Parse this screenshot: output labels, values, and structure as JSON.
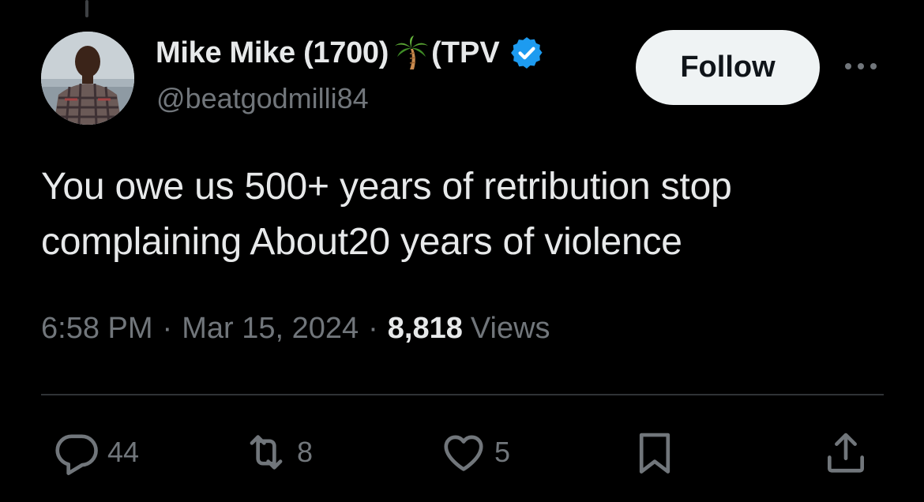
{
  "tweet": {
    "display_name": "Mike Mike (1700)",
    "name_emoji": "palm-tree",
    "name_suffix": "(TPV",
    "verified": true,
    "handle": "@beatgodmilli84",
    "text": "You owe us 500+ years of retribution stop complaining About20 years of violence",
    "time": "6:58 PM",
    "separator": "·",
    "date": "Mar 15, 2024",
    "views_count": "8,818",
    "views_label": "Views"
  },
  "follow_label": "Follow",
  "actions": {
    "replies": "44",
    "retweets": "8",
    "likes": "5"
  },
  "icons": {
    "reply": "reply-bubble-icon",
    "retweet": "retweet-icon",
    "like": "heart-icon",
    "bookmark": "bookmark-icon",
    "share": "share-icon",
    "more": "more-dots-icon"
  },
  "colors": {
    "background": "#000000",
    "text_primary": "#e7e9ea",
    "text_secondary": "#71767b",
    "verified_blue": "#1d9bf0",
    "follow_bg": "#eff3f4",
    "divider": "#2f3336"
  }
}
